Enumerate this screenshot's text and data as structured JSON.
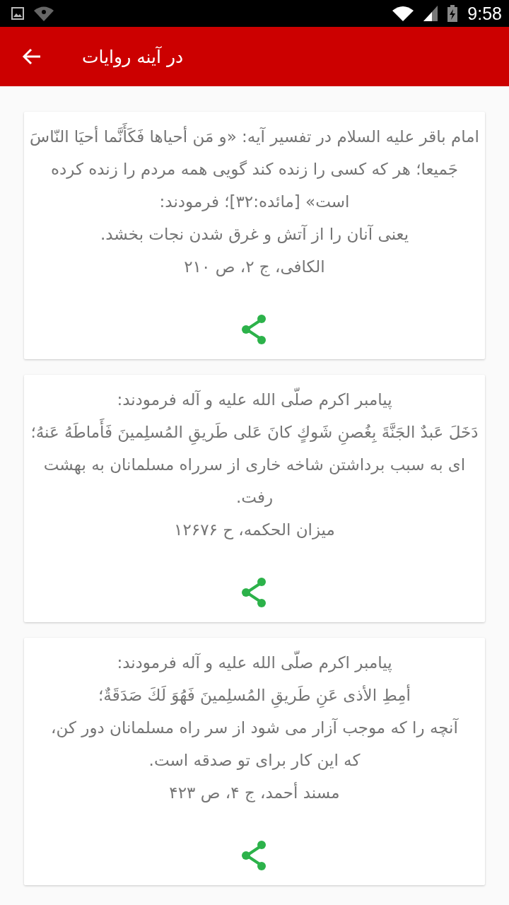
{
  "status_bar": {
    "time": "9:58"
  },
  "app_bar": {
    "title": "در آینه روایات"
  },
  "cards": [
    {
      "paragraphs": [
        "امام باقر علیه السلام در تفسیر آیه: «و مَن أحیاها فَكَأَنَّما أحيَا النّاسَ جَمیعا؛ هر كه كسی را زنده كند گویی همه مردم را زنده كرده است» [مائده:۳۲]؛ فرمودند:",
        "یعنی آنان را از آتش و غرق شدن نجات بخشد.",
        "الكافی، ج ۲، ص ۲۱۰"
      ]
    },
    {
      "paragraphs": [
        "پیامبر اکرم صلّی الله علیه و آله فرمودند:",
        "دَخَلَ عَبدٌ الجَنَّةَ بِغُصنِ شَوكٍ كانَ عَلی طَريقِ المُسلِمينَ فَأَماطَهُ عَنهُ؛",
        "ای به سبب برداشتن شاخه خاری از سرراه مسلمانان به بهشت رفت.",
        "ميزان الحكمه، ح ۱۲۶۷۶"
      ]
    },
    {
      "paragraphs": [
        "پیامبر اکرم صلّی الله علیه و آله فرمودند:",
        "أمِطِ الأذی عَنِ طَريقِ المُسلِمينَ فَهُوَ لَكَ صَدَقَةٌ؛",
        "آنچه را که موجب آزار می شود از سر راه مسلمانان دور کن،",
        "که این کار برای تو صدقه است.",
        "مسند أحمد، ج ۴، ص ۴۲۳"
      ]
    }
  ]
}
